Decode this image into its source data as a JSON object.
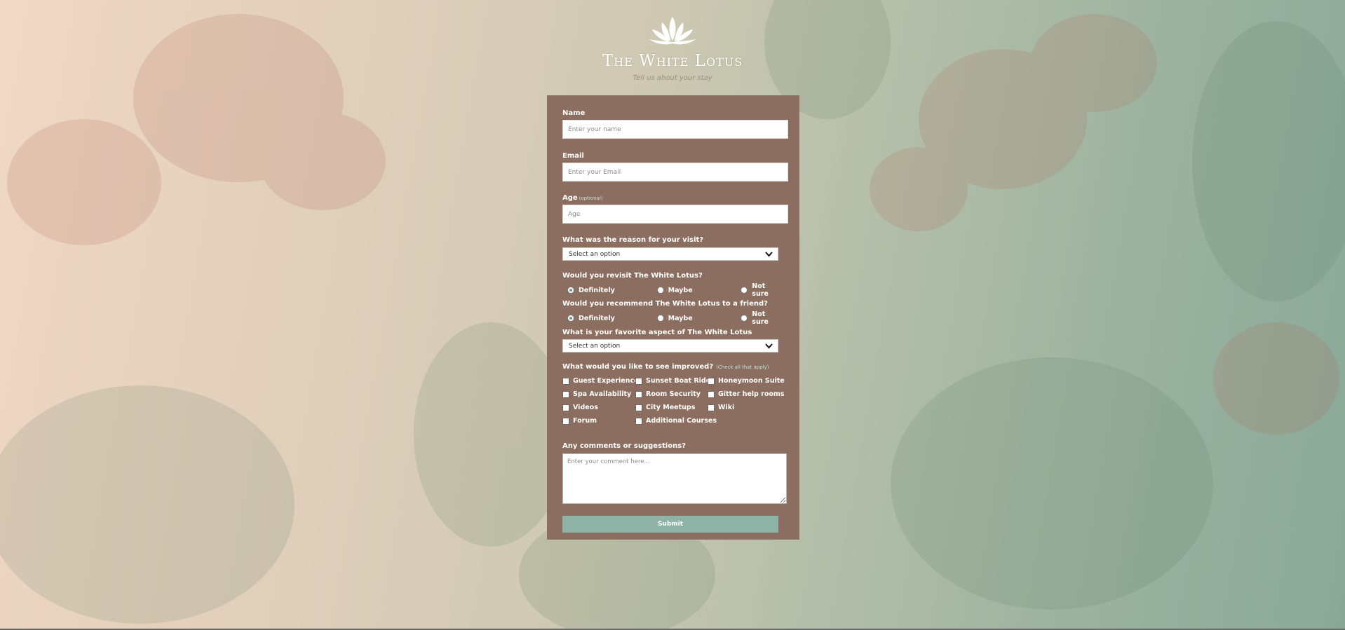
{
  "header": {
    "title": "The White Lotus",
    "subtitle": "Tell us about your stay"
  },
  "form": {
    "name": {
      "label": "Name",
      "placeholder": "Enter your name"
    },
    "email": {
      "label": "Email",
      "placeholder": "Enter your Email"
    },
    "age": {
      "label": "Age",
      "optional_hint": "(optional)",
      "placeholder": "Age"
    },
    "reason": {
      "label": "What was the reason for your visit?",
      "selected": "Select an option"
    },
    "revisit": {
      "label": "Would you revisit The White Lotus?",
      "options": [
        "Definitely",
        "Maybe",
        "Not sure"
      ],
      "selected": "Definitely"
    },
    "recommend": {
      "label": "Would you recommend The White Lotus to a friend?",
      "options": [
        "Definitely",
        "Maybe",
        "Not sure"
      ],
      "selected": "Definitely"
    },
    "favorite": {
      "label": "What is your favorite aspect of The White Lotus",
      "selected": "Select an option"
    },
    "improve": {
      "label": "What would you like to see improved?",
      "hint": "(Check all that apply)",
      "options": [
        "Guest Experience",
        "Sunset Boat Ride",
        "Honeymoon Suite",
        "Spa Availability",
        "Room Security",
        "Gitter help rooms",
        "Videos",
        "City Meetups",
        "Wiki",
        "Forum",
        "Additional Courses"
      ]
    },
    "comments": {
      "label": "Any comments or suggestions?",
      "placeholder": "Enter your comment here..."
    },
    "submit_label": "Submit"
  },
  "colors": {
    "card": "#8b6e5f",
    "submit": "#8fb3a7",
    "hint": "#c9e0d6"
  }
}
